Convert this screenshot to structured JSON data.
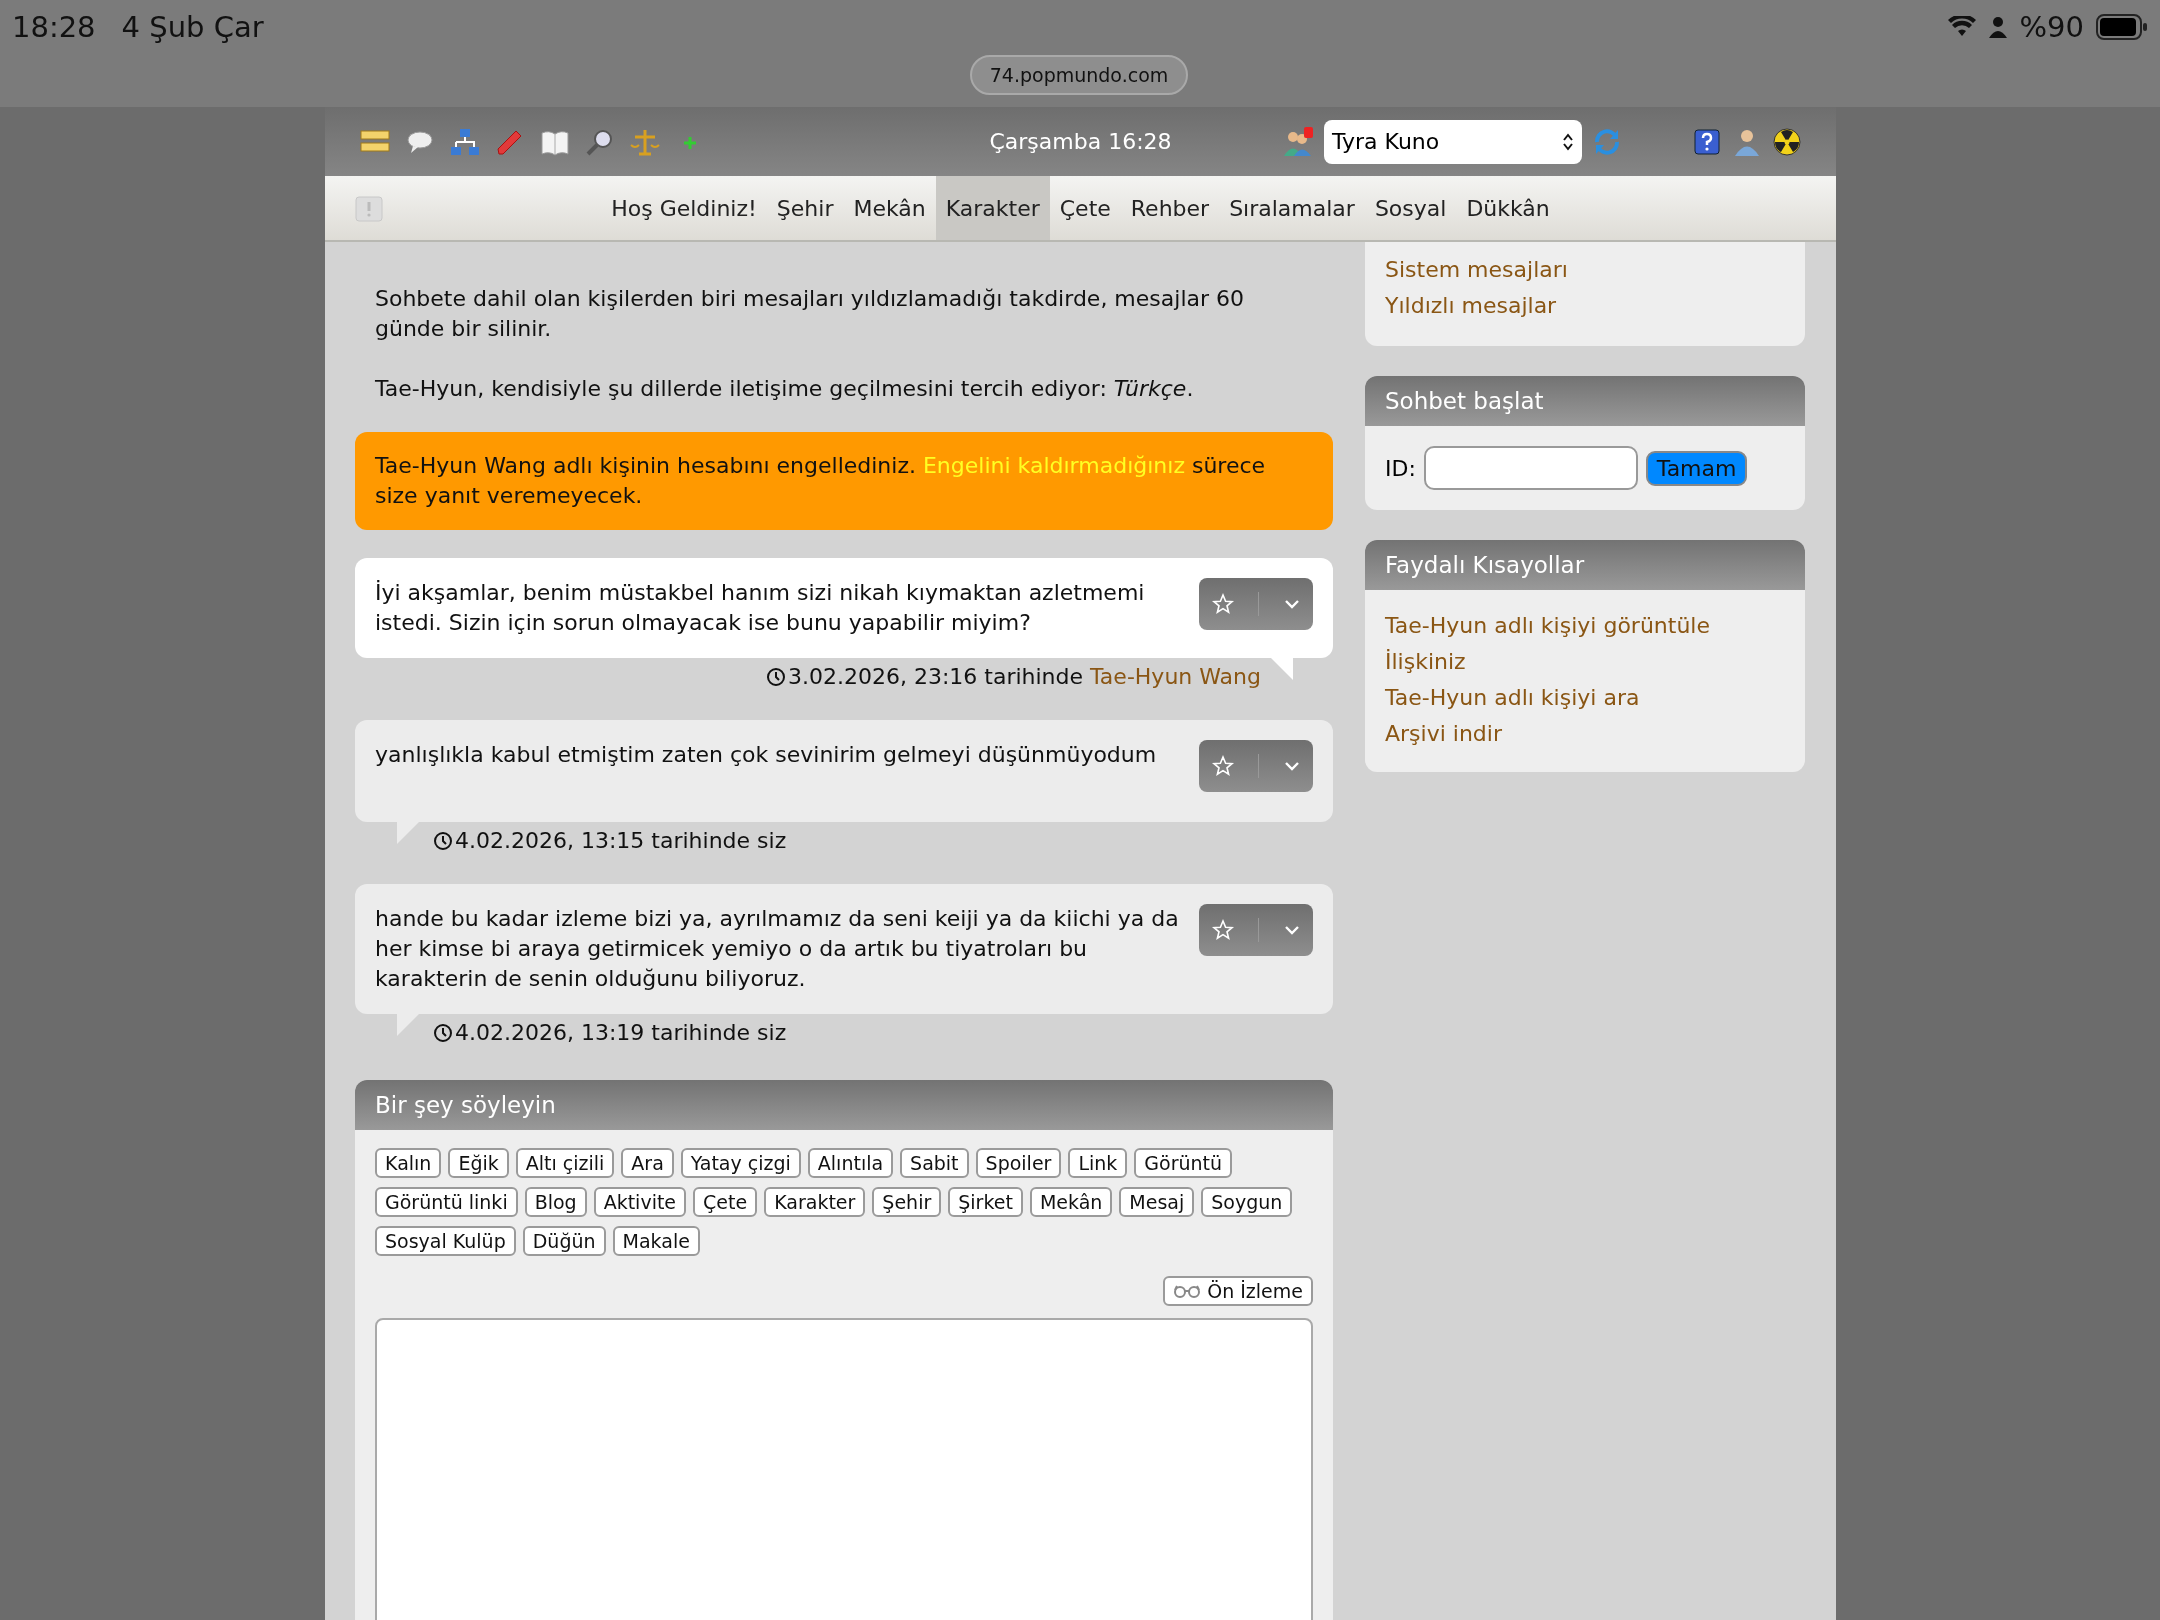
{
  "status_bar": {
    "time": "18:28",
    "date": "4 Şub Çar",
    "battery": "%90"
  },
  "browser": {
    "url": "74.popmundo.com"
  },
  "toolbar": {
    "date_time": "Çarşamba 16:28",
    "character_select": {
      "value": "Tyra Kuno"
    }
  },
  "nav": {
    "items": [
      {
        "label": "Hoş Geldiniz!",
        "selected": false
      },
      {
        "label": "Şehir",
        "selected": false
      },
      {
        "label": "Mekân",
        "selected": false
      },
      {
        "label": "Karakter",
        "selected": true
      },
      {
        "label": "Çete",
        "selected": false
      },
      {
        "label": "Rehber",
        "selected": false
      },
      {
        "label": "Sıralamalar",
        "selected": false
      },
      {
        "label": "Sosyal",
        "selected": false
      },
      {
        "label": "Dükkân",
        "selected": false
      }
    ]
  },
  "info_paragraphs": [
    "Sohbete dahil olan kişilerden biri mesajları yıldızlamadığı takdirde, mesajlar 60 günde bir silinir.",
    "Tae-Hyun, kendisiyle şu dillerde iletişime geçilmesini tercih ediyor: *Türkçe*."
  ],
  "alert": {
    "text_before": "Tae-Hyun Wang adlı kişinin hesabını engellediniz.",
    "link": "Engelini kaldırmadığınız",
    "text_after": "sürece size yanıt veremeyecek."
  },
  "messages": [
    {
      "kind": "received",
      "text": "İyi akşamlar, benim müstakbel hanım sizi nikah kıymaktan azletmemi istedi. Sizin için sorun olmayacak ise bunu yapabilir miyim?",
      "timestamp": "3.02.2026, 23:16 tarihinde",
      "author": "Tae-Hyun Wang",
      "starred": false
    },
    {
      "kind": "sent",
      "text": "yanlışlıkla kabul etmiştim zaten çok sevinirim gelmeyi düşünmüyodum",
      "timestamp": "4.02.2026, 13:15 tarihinde",
      "author": "siz",
      "starred": false
    },
    {
      "kind": "sent",
      "text": "hande bu kadar izleme bizi ya, ayrılmamız da seni keiji ya da kiichi ya da her kimse bi araya getirmicek yemiyo o da artık bu tiyatroları bu karakterin de senin olduğunu biliyoruz.",
      "timestamp": "4.02.2026, 13:19 tarihinde",
      "author": "siz",
      "starred": false
    }
  ],
  "compose": {
    "title": "Bir şey söyleyin",
    "format_buttons": [
      "Kalın",
      "Eğik",
      "Altı çizili",
      "Ara",
      "Yatay çizgi",
      "Alıntıla",
      "Sabit",
      "Spoiler",
      "Link",
      "Görüntü",
      "Görüntü linki",
      "Blog",
      "Aktivite",
      "Çete",
      "Karakter",
      "Şehir",
      "Şirket",
      "Mekân",
      "Mesaj",
      "Soygun",
      "Sosyal Kulüp",
      "Düğün",
      "Makale"
    ],
    "preview_button": "Ön İzleme"
  },
  "sidebar": {
    "message_links": [
      "Sistem mesajları",
      "Yıldızlı mesajlar"
    ],
    "start_chat": {
      "title": "Sohbet başlat",
      "id_label": "ID:",
      "button": "Tamam"
    },
    "shortcuts": {
      "title": "Faydalı Kısayollar",
      "links": [
        "Tae-Hyun adlı kişiyi görüntüle",
        "İlişkiniz",
        "Tae-Hyun adlı kişiyi ara",
        "Arşivi indir"
      ]
    }
  }
}
